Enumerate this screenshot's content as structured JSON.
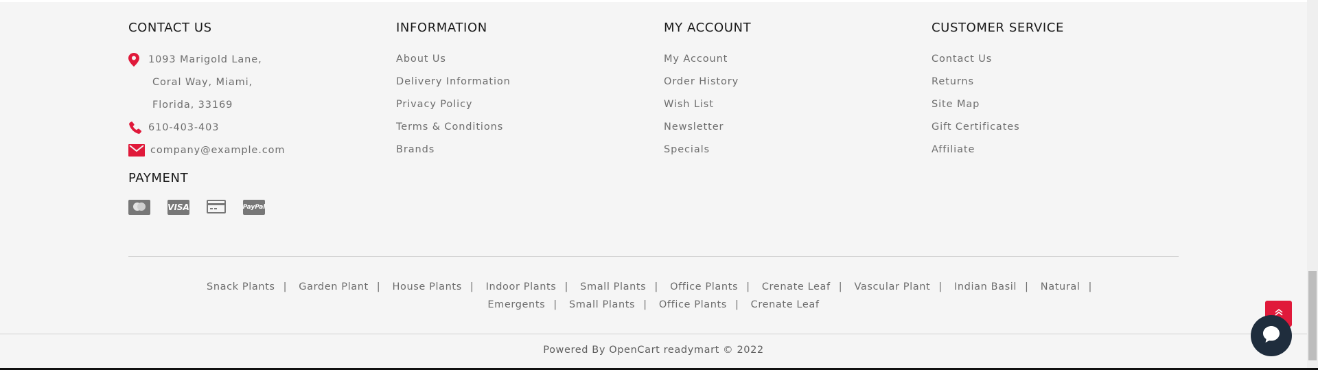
{
  "contact": {
    "title": "CONTACT US",
    "address_line1": "1093 Marigold Lane,",
    "address_line2": "Coral Way, Miami,",
    "address_line3": "Florida, 33169",
    "phone": "610-403-403",
    "email": "company@example.com",
    "icons": [
      "location-pin-icon",
      "phone-icon",
      "mail-icon"
    ],
    "icon_color": "#e0193a"
  },
  "information": {
    "title": "INFORMATION",
    "links": [
      "About Us",
      "Delivery Information",
      "Privacy Policy",
      "Terms & Conditions",
      "Brands"
    ]
  },
  "account": {
    "title": "MY ACCOUNT",
    "links": [
      "My Account",
      "Order History",
      "Wish List",
      "Newsletter",
      "Specials"
    ]
  },
  "service": {
    "title": "CUSTOMER SERVICE",
    "links": [
      "Contact Us",
      "Returns",
      "Site Map",
      "Gift Certificates",
      "Affiliate"
    ]
  },
  "payment": {
    "title": "PAYMENT",
    "visa_label": "VISA",
    "paypal_label": "PayPal",
    "icons": [
      "mastercard-icon",
      "visa-icon",
      "credit-card-icon",
      "paypal-icon"
    ]
  },
  "tags": {
    "line1": [
      "Snack Plants",
      "Garden Plant",
      "House Plants",
      "Indoor Plants",
      "Small Plants",
      "Office Plants",
      "Crenate Leaf",
      "Vascular Plant",
      "Indian Basil",
      "Natural"
    ],
    "line2": [
      "Emergents",
      "Small Plants",
      "Office Plants",
      "Crenate Leaf"
    ],
    "separator": "|"
  },
  "footer": {
    "powered": "Powered By OpenCart readymart © 2022"
  },
  "colors": {
    "accent": "#e0193a",
    "chat": "#1f2d3d",
    "background": "#f5f5f5"
  }
}
